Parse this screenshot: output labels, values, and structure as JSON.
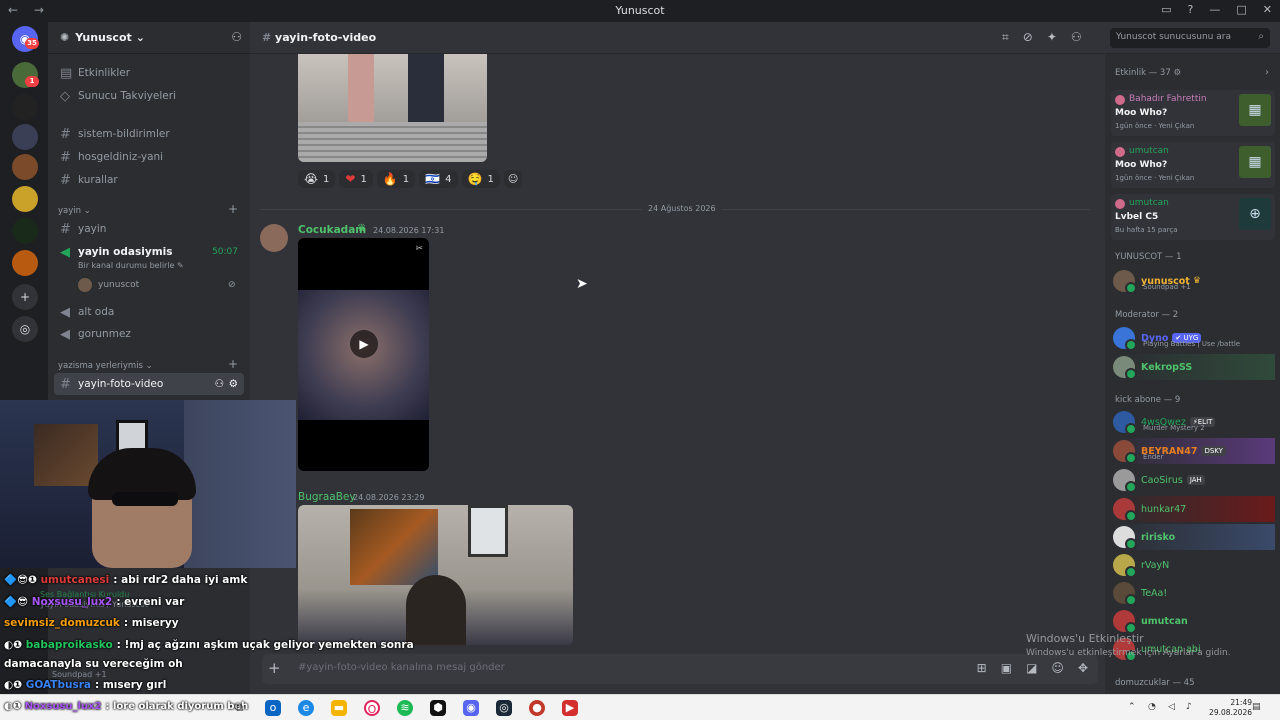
{
  "window": {
    "title": "Yunuscot"
  },
  "guilds": {
    "home_badge": "35",
    "badge2": "1"
  },
  "server": {
    "name": "Yunuscot"
  },
  "channels": {
    "top": [
      "Etkinlikler",
      "Sunucu Takviyeleri"
    ],
    "text": [
      "sistem-bildirimler",
      "hosgeldiniz-yani",
      "kurallar"
    ],
    "cat_yayin": "yayin",
    "yayin": "yayin",
    "voice_name": "yayin odasiymis",
    "voice_time": "50:07",
    "voice_status": "Bir kanal durumu belirle",
    "voice_user": "yunuscot",
    "alt_oda": "alt oda",
    "gorunmez": "gorunmez",
    "cat_yazisma": "yazisma yerleriymis",
    "active": "yayin-foto-video"
  },
  "header": {
    "channel": "yayin-foto-video",
    "search_placeholder": "Yunuscot sunucusunu ara"
  },
  "reactions": [
    {
      "emoji": "😭",
      "count": "1"
    },
    {
      "emoji": "❤",
      "count": "1"
    },
    {
      "emoji": "🔥",
      "count": "1"
    },
    {
      "emoji": "🇮🇱",
      "count": "4"
    },
    {
      "emoji": "🤤",
      "count": "1"
    }
  ],
  "divider_date": "24 Ağustos 2026",
  "messages": [
    {
      "author": "Cocukadam",
      "time": "24.08.2026 17:31",
      "color": "#4fc26b"
    },
    {
      "author": "BugraaBey",
      "time": "24.08.2026 23:29",
      "color": "#4fc26b"
    }
  ],
  "composer": {
    "placeholder": "#yayin-foto-video kanalına mesaj gönder"
  },
  "members": {
    "activity_head": "Etkinlik — 37",
    "activities": [
      {
        "name": "Bahadır Fahrettin",
        "game": "Moo Who?",
        "sub": "1gün önce · Yeni Çıkan",
        "color": "#c77dba"
      },
      {
        "name": "umutcan",
        "game": "Moo Who?",
        "sub": "1gün önce · Yeni Çıkan",
        "color": "#23a55a"
      },
      {
        "name": "umutcan",
        "game": "Lvbel C5",
        "sub": "Bu hafta 15 parça",
        "color": "#23a55a"
      }
    ],
    "group_owner": "YUNUSCOT — 1",
    "owner": {
      "name": "yunuscot",
      "sub": "Soundpad +1"
    },
    "group_mod": "Moderator — 2",
    "mods": [
      {
        "name": "Dyno",
        "tag": "✔ UYG",
        "sub": "Playing Battles | Use /battle"
      },
      {
        "name": "KekropSS",
        "tag": "",
        "sub": ""
      }
    ],
    "group_kick": "kick abone — 9",
    "kick": [
      {
        "name": "4wsQwez",
        "tag": "⚡ELIT",
        "sub": "Murder Mystery 2",
        "color": "#23a55a"
      },
      {
        "name": "BEYRAN47",
        "tag": "DSKY",
        "sub": "Ender",
        "color": "#e67e22"
      },
      {
        "name": "CaoSirus",
        "tag": "JAH",
        "sub": "",
        "color": "#4fc26b"
      },
      {
        "name": "hunkar47",
        "tag": "",
        "sub": "",
        "color": "#4fc26b"
      },
      {
        "name": "ririsko",
        "tag": "",
        "sub": "",
        "color": "#4fc26b"
      },
      {
        "name": "rVayN",
        "tag": "",
        "sub": "",
        "color": "#4fc26b"
      },
      {
        "name": "TeAa!",
        "tag": "",
        "sub": "",
        "color": "#4fc26b"
      },
      {
        "name": "umutcan",
        "tag": "",
        "sub": "",
        "color": "#4fc26b"
      },
      {
        "name": "umutcan abi",
        "tag": "",
        "sub": "",
        "color": "#4fc26b"
      }
    ],
    "group_domuz": "domuzcuklar — 45"
  },
  "watermark": {
    "line1": "Windows'u Etkinleştir",
    "line2": "Windows'u etkinleştirmek için Ayarlar'a gidin."
  },
  "overlay": {
    "voice_connected": "Ses Bağlantısı Kuruldu",
    "voice_sub": "yayin odasiymis / Yunuscot",
    "soundpad": "Soundpad +1"
  },
  "chat": [
    {
      "user": "umutcanesi",
      "text": ": abi rdr2 daha iyi amk",
      "color": "#e03b3b"
    },
    {
      "user": "Noxsusu_lux2",
      "text": ": evreni var",
      "color": "#a855f7"
    },
    {
      "user": "sevimsiz_domuzcuk",
      "text": ": miseryy",
      "color": "#f59e0b"
    },
    {
      "user": "babaproikasko",
      "text": ": !mj aç ağzını aşkım uçak geliyor yemekten sonra",
      "color": "#22c55e"
    },
    {
      "user": "",
      "text": "damacanayla su vereceğim oh",
      "color": "#ffffff"
    },
    {
      "user": "GOATbusra",
      "text": ": mısery gırl",
      "color": "#3b82f6"
    },
    {
      "user": "Noxsusu_lux2",
      "text": ": lore olarak diyorum beh",
      "color": "#a855f7"
    }
  ],
  "tray": {
    "time": "21:49",
    "date": "29.08.2026"
  }
}
